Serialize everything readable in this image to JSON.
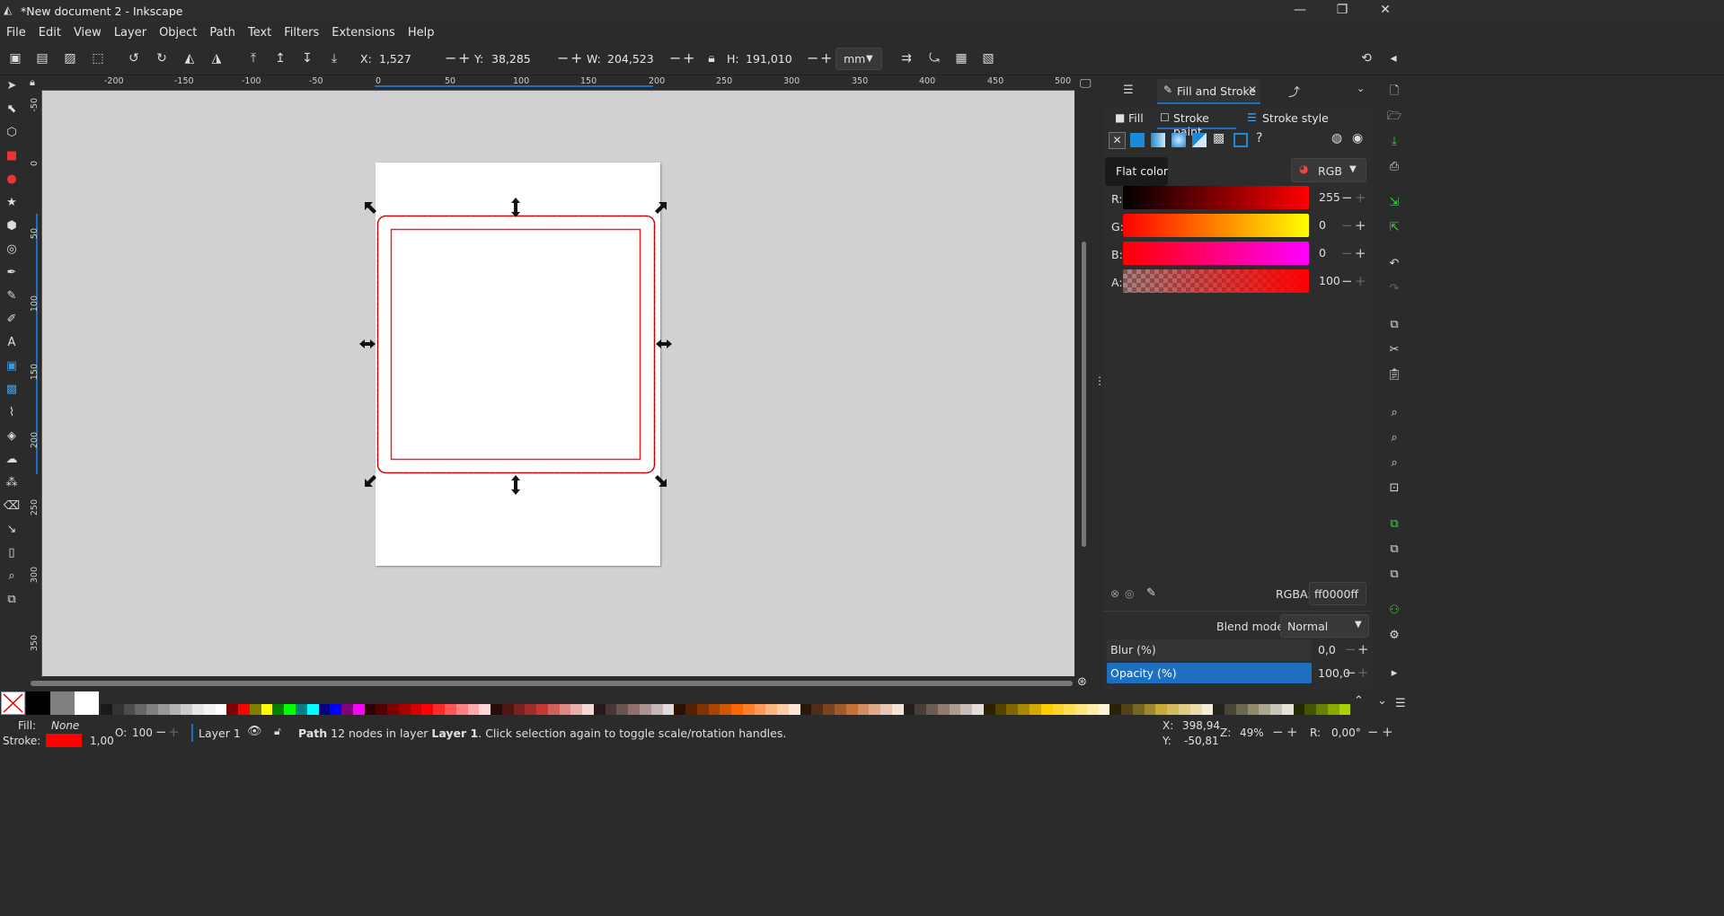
{
  "window": {
    "title": "*New document 2 - Inkscape"
  },
  "menu": [
    "File",
    "Edit",
    "View",
    "Layer",
    "Object",
    "Path",
    "Text",
    "Filters",
    "Extensions",
    "Help"
  ],
  "toolbar": {
    "x_label": "X:",
    "x_value": "1,527",
    "y_label": "Y:",
    "y_value": "38,285",
    "w_label": "W:",
    "w_value": "204,523",
    "h_label": "H:",
    "h_value": "191,010",
    "unit": "mm"
  },
  "ruler": {
    "h_ticks": [
      "-200",
      "-150",
      "-100",
      "-50",
      "0",
      "50",
      "100",
      "150",
      "200",
      "250",
      "300",
      "350",
      "400",
      "450",
      "500"
    ],
    "v_ticks": [
      "-50",
      "0",
      "50",
      "100",
      "150",
      "200",
      "250",
      "300",
      "350"
    ]
  },
  "panel": {
    "tab_label": "Fill and Stroke",
    "subtabs": {
      "fill": "Fill",
      "stroke_paint": "Stroke paint",
      "stroke_style": "Stroke style"
    },
    "tooltip": "Flat color",
    "color_mode": "RGB",
    "channels": [
      {
        "label": "R:",
        "value": "255"
      },
      {
        "label": "G:",
        "value": "0"
      },
      {
        "label": "B:",
        "value": "0"
      },
      {
        "label": "A:",
        "value": "100"
      }
    ],
    "rgba_label": "RGBA:",
    "rgba_value": "ff0000ff",
    "blend_label": "Blend mode:",
    "blend_value": "Normal",
    "blur_label": "Blur (%)",
    "blur_value": "0,0",
    "opacity_label": "Opacity (%)",
    "opacity_value": "100,0"
  },
  "status": {
    "fill_label": "Fill:",
    "fill_value": "None",
    "stroke_label": "Stroke:",
    "stroke_width": "1,00",
    "stroke_color": "#ff0000",
    "opacity_label": "O:",
    "opacity_value": "100",
    "layer": "Layer 1",
    "message_bold": "Path",
    "message_rest": " 12 nodes in layer ",
    "message_layer": "Layer 1",
    "message_end": ". Click selection again to toggle scale/rotation handles.",
    "cursor_x_label": "X:",
    "cursor_x": "398,94",
    "cursor_y_label": "Y:",
    "cursor_y": "-50,81",
    "zoom_label": "Z:",
    "zoom": "49%",
    "rotation_label": "R:",
    "rotation": "0,00°"
  },
  "colors": {
    "accent": "#1e6fc0",
    "stroke": "#ff0000",
    "canvas": "#d1d1d1"
  }
}
